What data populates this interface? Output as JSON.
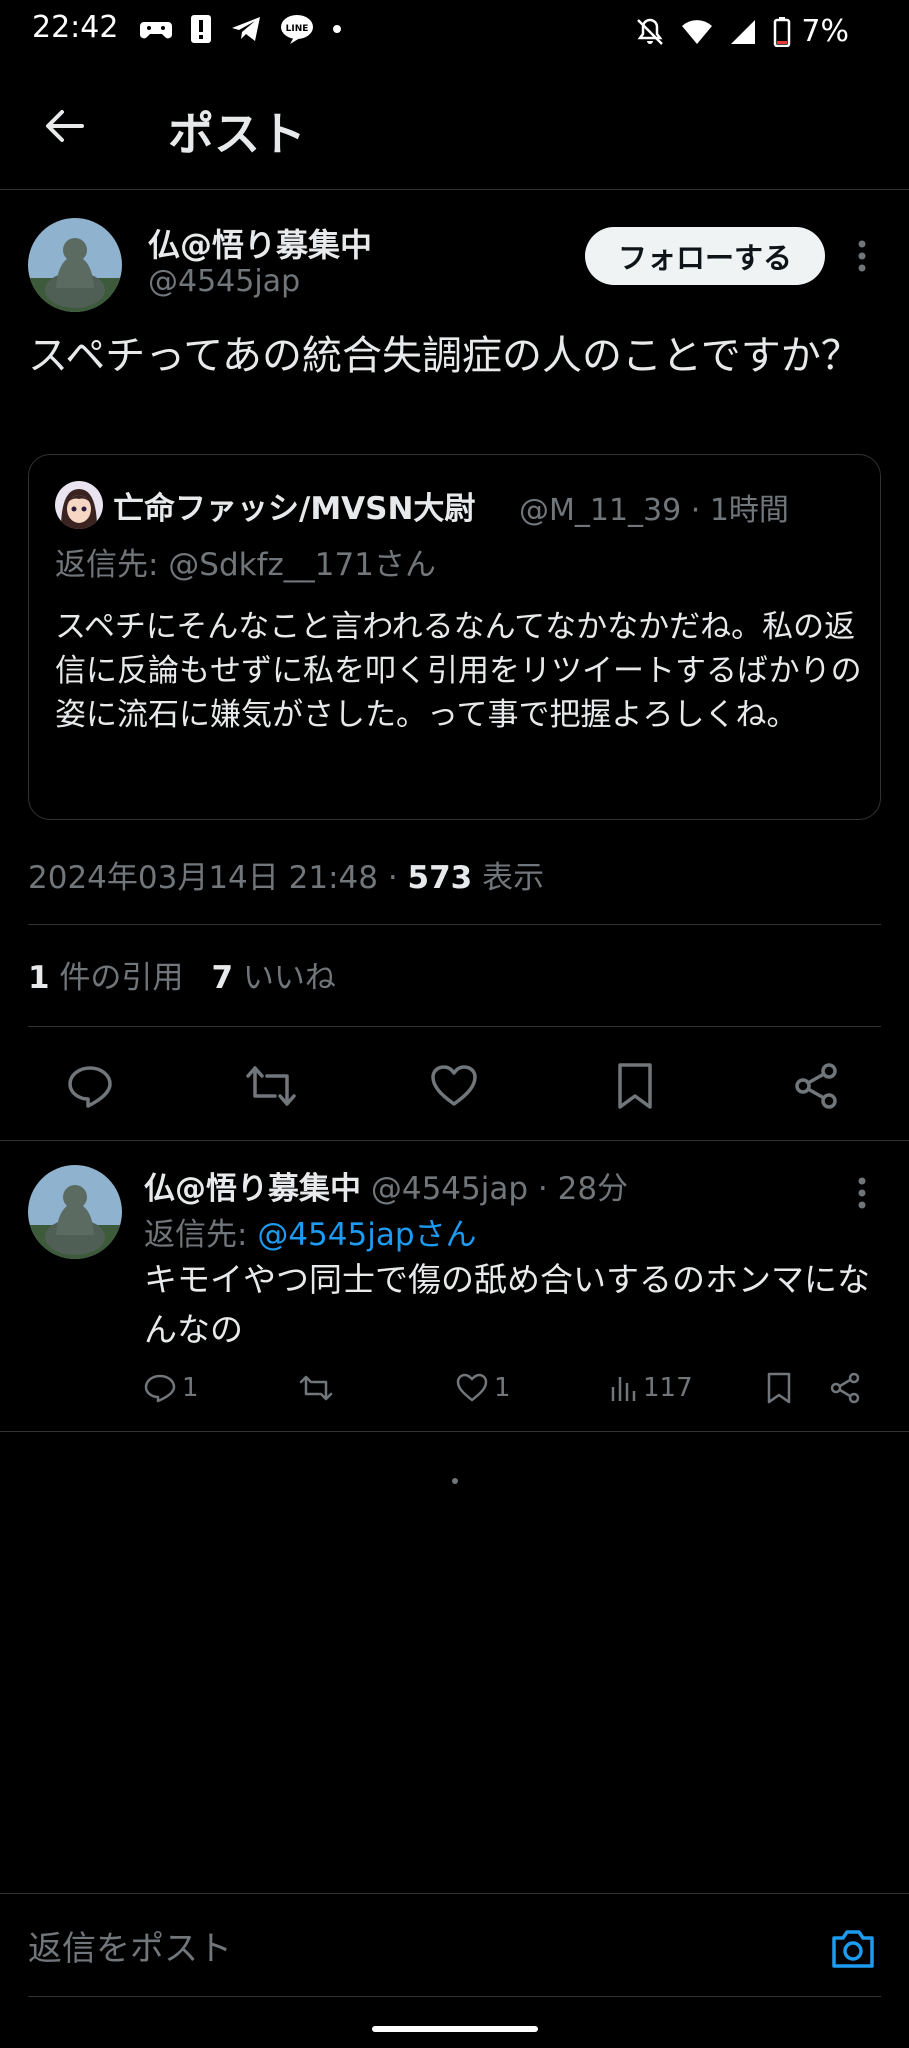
{
  "status_bar": {
    "time": "22:42",
    "battery": "7%",
    "icons": [
      "game-controller-icon",
      "alert-icon",
      "telegram-icon",
      "line-icon",
      "dot-icon",
      "mute-icon",
      "wifi-icon",
      "signal-icon",
      "battery-icon"
    ]
  },
  "header": {
    "title": "ポスト"
  },
  "post": {
    "author_name": "仏@悟り募集中",
    "author_handle": "@4545jap",
    "follow_label": "フォローする",
    "text": "スペチってあの統合失調症の人のことですか？",
    "quote": {
      "name": "亡命ファッシ/MVSN大尉",
      "meta": "@M_11_39 · 1時間",
      "reply_to": "返信先: @Sdkfz__171さん",
      "text": "スペチにそんなこと言われるなんてなかなかだね。私の返信に反論もせずに私を叩く引用をリツイートするばかりの姿に流石に嫌気がさした。って事で把握よろしくね。"
    },
    "date": "2024年03月14日 21:48 · ",
    "views_count": "573",
    "views_label": " 表示",
    "quotes_count": "1",
    "quotes_label": " 件の引用",
    "likes_count": "7",
    "likes_label": " いいね"
  },
  "reply": {
    "author_name": "仏@悟り募集中",
    "meta": " @4545jap · 28分",
    "reply_to_prefix": "返信先: ",
    "reply_to_link": "@4545japさん",
    "text": "キモイやつ同士で傷の舐め合いするのホンマになんなの",
    "reply_count": "1",
    "like_count": "1",
    "view_count": "117"
  },
  "composer": {
    "placeholder": "返信をポスト"
  },
  "colors": {
    "background": "#000000",
    "text": "#e7e9ea",
    "muted": "#71767b",
    "link": "#1d9bf0",
    "border": "#2f3336"
  }
}
